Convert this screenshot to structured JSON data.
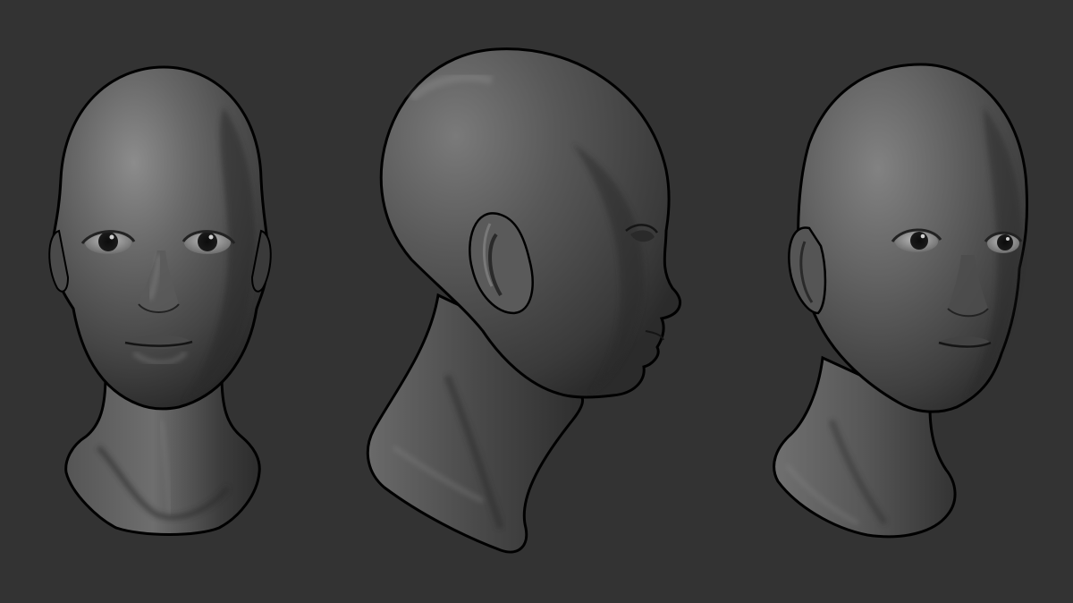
{
  "scene": {
    "background_color": "#333333",
    "subject": "sculpted bust",
    "material_color": "#5a5a5a",
    "outline_color": "#000000",
    "views": [
      {
        "view": "front"
      },
      {
        "view": "profile-right"
      },
      {
        "view": "three-quarter-right"
      }
    ]
  }
}
